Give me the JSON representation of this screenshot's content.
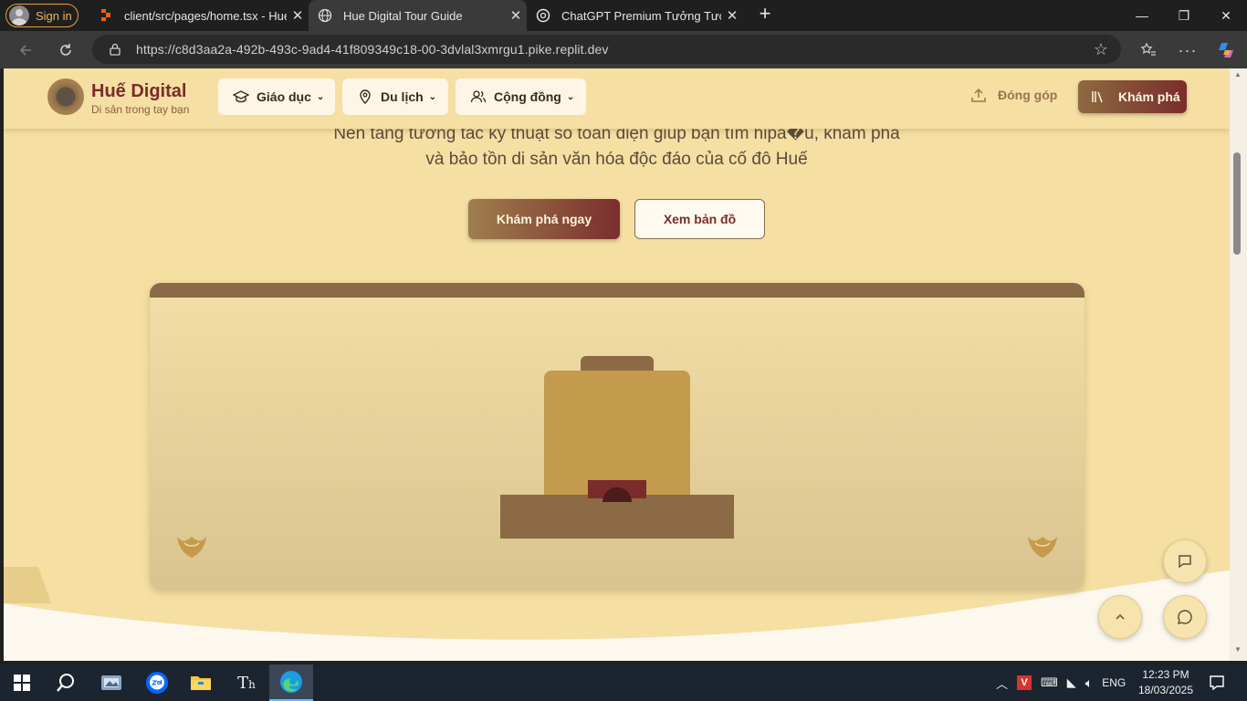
{
  "browser": {
    "signin_label": "Sign in",
    "tabs": [
      {
        "title": "client/src/pages/home.tsx - HueD",
        "icon": "replit-icon"
      },
      {
        "title": "Hue Digital Tour Guide",
        "icon": "globe-icon"
      },
      {
        "title": "ChatGPT Premium Tưởng Tượng",
        "icon": "openai-icon"
      }
    ],
    "url": "https://c8d3aa2a-492b-493c-9ad4-41f809349c18-00-3dvlal3xmrgu1.pike.replit.dev"
  },
  "site": {
    "brand_name": "Huế Digital",
    "brand_tagline": "Di sản trong tay bạn",
    "nav": [
      {
        "label": "Giáo dục",
        "icon": "graduation-cap-icon"
      },
      {
        "label": "Du lịch",
        "icon": "map-pin-icon"
      },
      {
        "label": "Cộng đồng",
        "icon": "users-icon"
      }
    ],
    "contribute_label": "Đóng góp",
    "explore_label": "Khám phá"
  },
  "hero": {
    "subtitle_line1": "Nền tảng tương tác kỹ thuật số toàn diện giúp bạn tìm hipa�u, khám phá",
    "subtitle_line2": "và bảo tồn di sản văn hóa độc đáo của cố đô Huế",
    "primary_cta": "Khám phá ngay",
    "secondary_cta": "Xem bản đồ"
  },
  "taskbar": {
    "language": "ENG",
    "time": "12:23 PM",
    "date": "18/03/2025",
    "apps": [
      "start-icon",
      "search-icon",
      "app-icon",
      "zalo-icon",
      "file-explorer-icon",
      "text-editor-icon",
      "edge-icon"
    ]
  },
  "colors": {
    "page_bg": "#f5dfa3",
    "brand_maroon": "#7a2b2b",
    "brown": "#8b6a45",
    "gold": "#c49a4c"
  }
}
